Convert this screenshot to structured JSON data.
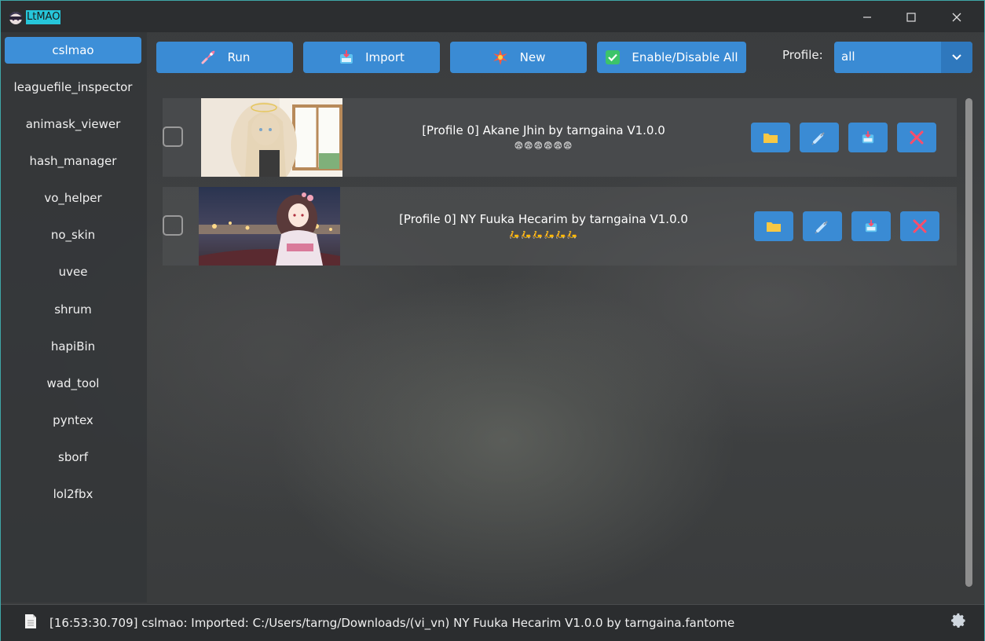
{
  "app": {
    "title": "LtMAO"
  },
  "window_controls": {
    "minimize_icon": "minimize-icon",
    "maximize_icon": "maximize-icon",
    "close_icon": "close-icon"
  },
  "sidebar": {
    "items": [
      {
        "label": "cslmao",
        "active": true
      },
      {
        "label": "leaguefile_inspector"
      },
      {
        "label": "animask_viewer"
      },
      {
        "label": "hash_manager"
      },
      {
        "label": "vo_helper"
      },
      {
        "label": "no_skin"
      },
      {
        "label": "uvee"
      },
      {
        "label": "shrum"
      },
      {
        "label": "hapiBin"
      },
      {
        "label": "wad_tool"
      },
      {
        "label": "pyntex"
      },
      {
        "label": "sborf"
      },
      {
        "label": "lol2fbx"
      }
    ]
  },
  "toolbar": {
    "run_label": "Run",
    "import_label": "Import",
    "new_label": "New",
    "enable_disable_label": "Enable/Disable All",
    "profile_label": "Profile:",
    "profile_value": "all"
  },
  "mods": [
    {
      "name": "[Profile 0] Akane Jhin by tarngaina V1.0.0",
      "description": "😨😨😨😨😨😨",
      "enabled": false
    },
    {
      "name": "[Profile 0] NY Fuuka Hecarim by tarngaina V1.0.0",
      "description": "🛵🛵🛵🛵🛵🛵",
      "enabled": false
    }
  ],
  "status": {
    "message": "[16:53:30.709] cslmao: Imported: C:/Users/tarng/Downloads/(vi_vn) NY Fuuka Hecarim V1.0.0 by tarngaina.fantome"
  },
  "colors": {
    "accent": "#3a8bd4",
    "title_highlight": "#26c6da",
    "delete_icon": "#ff4d6a",
    "folder_icon": "#f7c844"
  }
}
